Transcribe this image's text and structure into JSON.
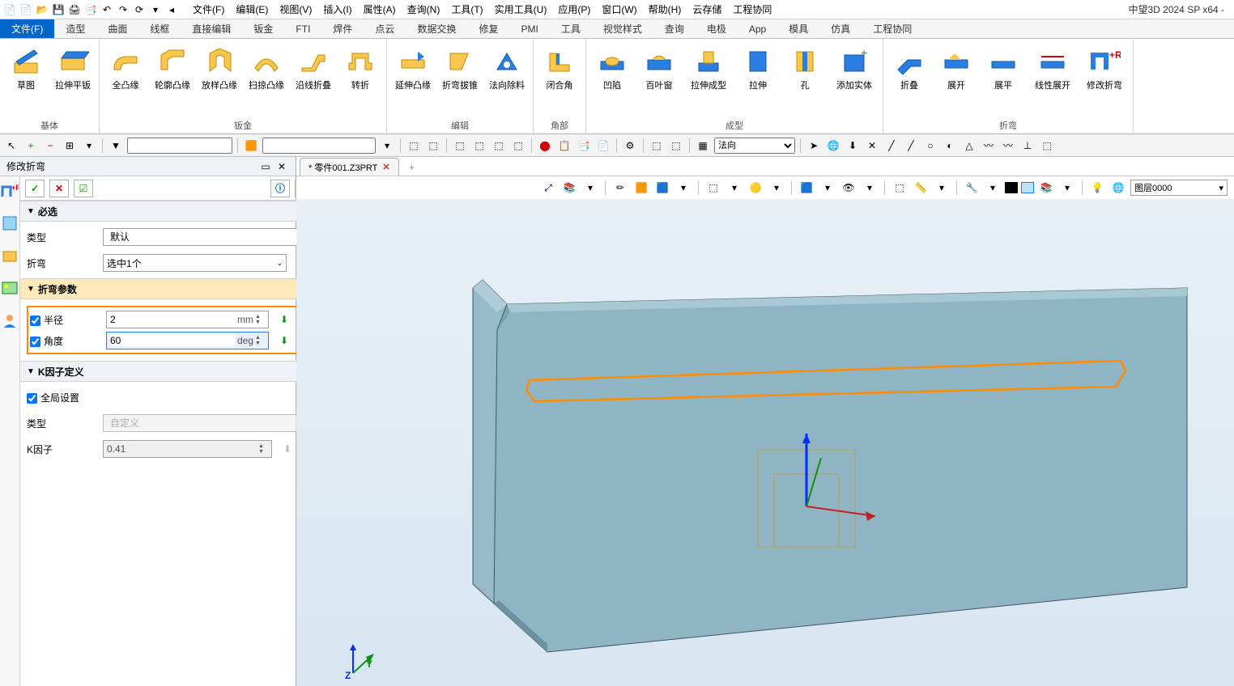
{
  "app_title": "中望3D 2024 SP x64 -",
  "menus": [
    "文件(F)",
    "编辑(E)",
    "视图(V)",
    "插入(I)",
    "属性(A)",
    "查询(N)",
    "工具(T)",
    "实用工具(U)",
    "应用(P)",
    "窗口(W)",
    "帮助(H)",
    "云存储",
    "工程协同"
  ],
  "ribbon_tabs": [
    "文件(F)",
    "造型",
    "曲面",
    "线框",
    "直接编辑",
    "钣金",
    "FTI",
    "焊件",
    "点云",
    "数据交换",
    "修复",
    "PMI",
    "工具",
    "视觉样式",
    "查询",
    "电极",
    "App",
    "模具",
    "仿真",
    "工程协同"
  ],
  "active_tab": 0,
  "ribbon_groups": [
    {
      "label": "基体",
      "items": [
        "草图",
        "拉伸平钣"
      ]
    },
    {
      "label": "钣金",
      "items": [
        "全凸缘",
        "轮廓凸缘",
        "放样凸缘",
        "扫掠凸缘",
        "沿线折叠",
        "转折"
      ]
    },
    {
      "label": "编辑",
      "items": [
        "延伸凸缘",
        "折弯拔锥",
        "法向除料"
      ]
    },
    {
      "label": "角部",
      "items": [
        "闭合角"
      ]
    },
    {
      "label": "成型",
      "items": [
        "凹陷",
        "百叶窗",
        "拉伸成型",
        "拉伸",
        "孔",
        "添加实体"
      ]
    },
    {
      "label": "折弯",
      "items": [
        "折叠",
        "展开",
        "展平",
        "线性展开",
        "修改折弯"
      ]
    }
  ],
  "toolbar_dir_label": "法向",
  "panel": {
    "title": "修改折弯",
    "sections": {
      "required": {
        "title": "必选",
        "type_label": "类型",
        "type_value": "默认",
        "bend_label": "折弯",
        "bend_value": "选中1个"
      },
      "params": {
        "title": "折弯参数",
        "radius_label": "半径",
        "radius_value": "2",
        "radius_unit": "mm",
        "angle_label": "角度",
        "angle_value": "60",
        "angle_unit": "deg"
      },
      "kfactor": {
        "title": "K因子定义",
        "global_label": "全局设置",
        "type_label": "类型",
        "type_value": "自定义",
        "k_label": "K因子",
        "k_value": "0.41"
      }
    }
  },
  "doc_tab": "* 零件001.Z3PRT",
  "layer_combo": "图层0000",
  "axis": {
    "z": "Z",
    "y": "Y"
  }
}
